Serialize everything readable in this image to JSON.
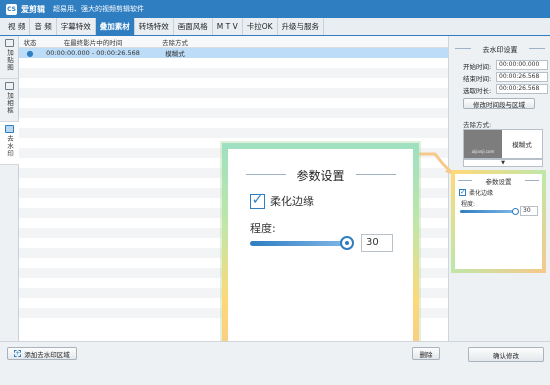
{
  "app": {
    "logo_text": "CS",
    "name": "爱剪辑",
    "slogan": "超易用、强大的视频剪辑软件"
  },
  "menu": [
    "视 频",
    "音 频",
    "字幕特效",
    "叠加素材",
    "转场特效",
    "画面风格",
    "M T V",
    "卡拉OK",
    "升级与服务"
  ],
  "side_tabs": [
    "加贴图",
    "加相框",
    "去水印"
  ],
  "list": {
    "headers": {
      "status": "状态",
      "time": "在最终影片中的时间",
      "mode": "去除方式"
    },
    "rows": [
      {
        "time": "00:00:00.000 - 00:00:26.568",
        "mode": "模糊式"
      }
    ]
  },
  "right_panel": {
    "title": "去水印设置",
    "start_label": "开始时间:",
    "start_value": "00:00:00.000",
    "end_label": "结束时间:",
    "end_value": "00:00:26.568",
    "duration_label": "选取时长:",
    "duration_value": "00:00:26.568",
    "modify_button": "修改时间段与区域",
    "mode_label": "去除方式:",
    "mode_value": "模糊式",
    "thumb_text": "aijianji.com"
  },
  "params": {
    "title": "参数设置",
    "soften_edges_label": "柔化边缘",
    "degree_label": "程度:",
    "degree_value": "30",
    "degree_fraction": 1.0
  },
  "bottom": {
    "add_button": "添加去水印区域",
    "delete_button": "删除",
    "confirm_button": "确认修改"
  }
}
